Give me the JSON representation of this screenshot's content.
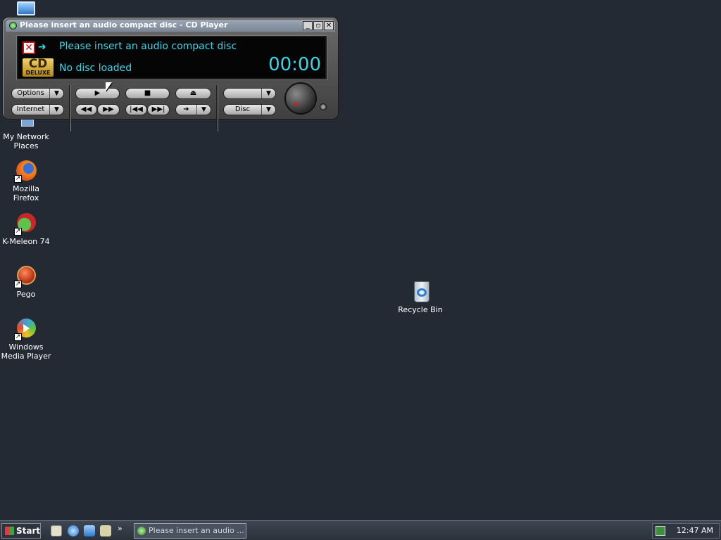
{
  "cd_player": {
    "title": "Please insert an audio compact disc - CD Player",
    "message": "Please insert an audio compact disc",
    "status": "No disc loaded",
    "time": "00:00",
    "logo_text": "CD",
    "logo_sub": "DELUXE",
    "options_label": "Options",
    "internet_label": "Internet",
    "disc_label": "Disc",
    "track_select_value": ""
  },
  "desktop_icons": [
    {
      "label": "My Network Places",
      "icon": "network-icon"
    },
    {
      "label": "Mozilla Firefox",
      "icon": "firefox-icon"
    },
    {
      "label": "K-Meleon 74",
      "icon": "kmeleon-icon"
    },
    {
      "label": "Pego",
      "icon": "pego-icon"
    },
    {
      "label": "Windows Media Player",
      "icon": "media-player-icon"
    },
    {
      "label": "Recycle Bin",
      "icon": "recycle-bin-icon"
    }
  ],
  "taskbar": {
    "start_label": "Start",
    "active_task": "Please insert an audio ...",
    "clock": "12:47 AM"
  },
  "colors": {
    "desktop_bg": "#232a34",
    "display_text": "#36d7e8"
  }
}
